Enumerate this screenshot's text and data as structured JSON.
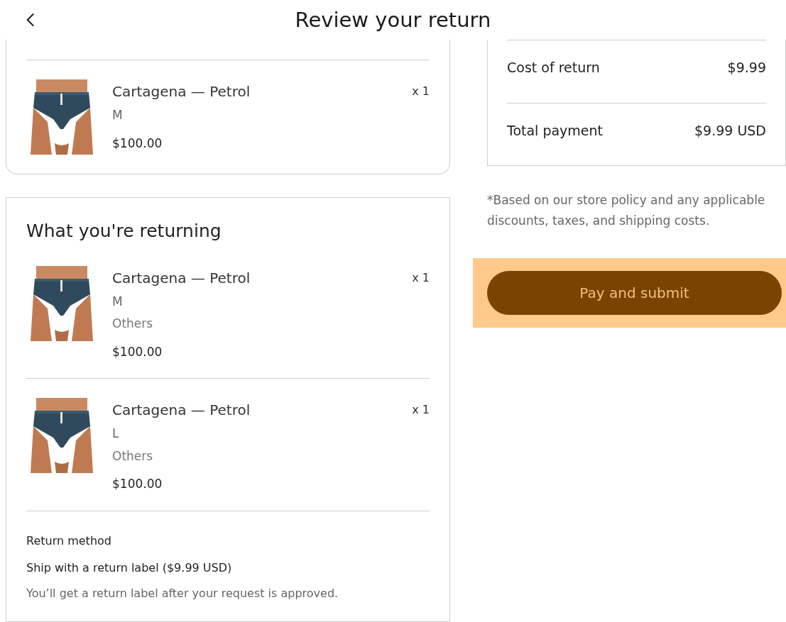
{
  "header": {
    "title": "Review your return"
  },
  "order_items": [
    {
      "name": "Cartagena — Petrol",
      "size": "M",
      "price": "$100.00",
      "quantity": "x 1"
    }
  ],
  "returning": {
    "heading": "What you're returning",
    "items": [
      {
        "name": "Cartagena — Petrol",
        "size": "M",
        "reason": "Others",
        "price": "$100.00",
        "quantity": "x 1"
      },
      {
        "name": "Cartagena — Petrol",
        "size": "L",
        "reason": "Others",
        "price": "$100.00",
        "quantity": "x 1"
      }
    ],
    "return_method": {
      "label": "Return method",
      "method": "Ship with a return label ($9.99 USD)",
      "note": "You’ll get a return label after your request is approved."
    }
  },
  "summary": {
    "rows": [
      {
        "label": "Cost of return",
        "value": "$9.99"
      },
      {
        "label": "Total payment",
        "value": "$9.99 USD"
      }
    ]
  },
  "note": "*Based on our store policy and any applicable discounts, taxes, and shipping costs.",
  "submit": {
    "label": "Pay and submit",
    "focused": true
  }
}
